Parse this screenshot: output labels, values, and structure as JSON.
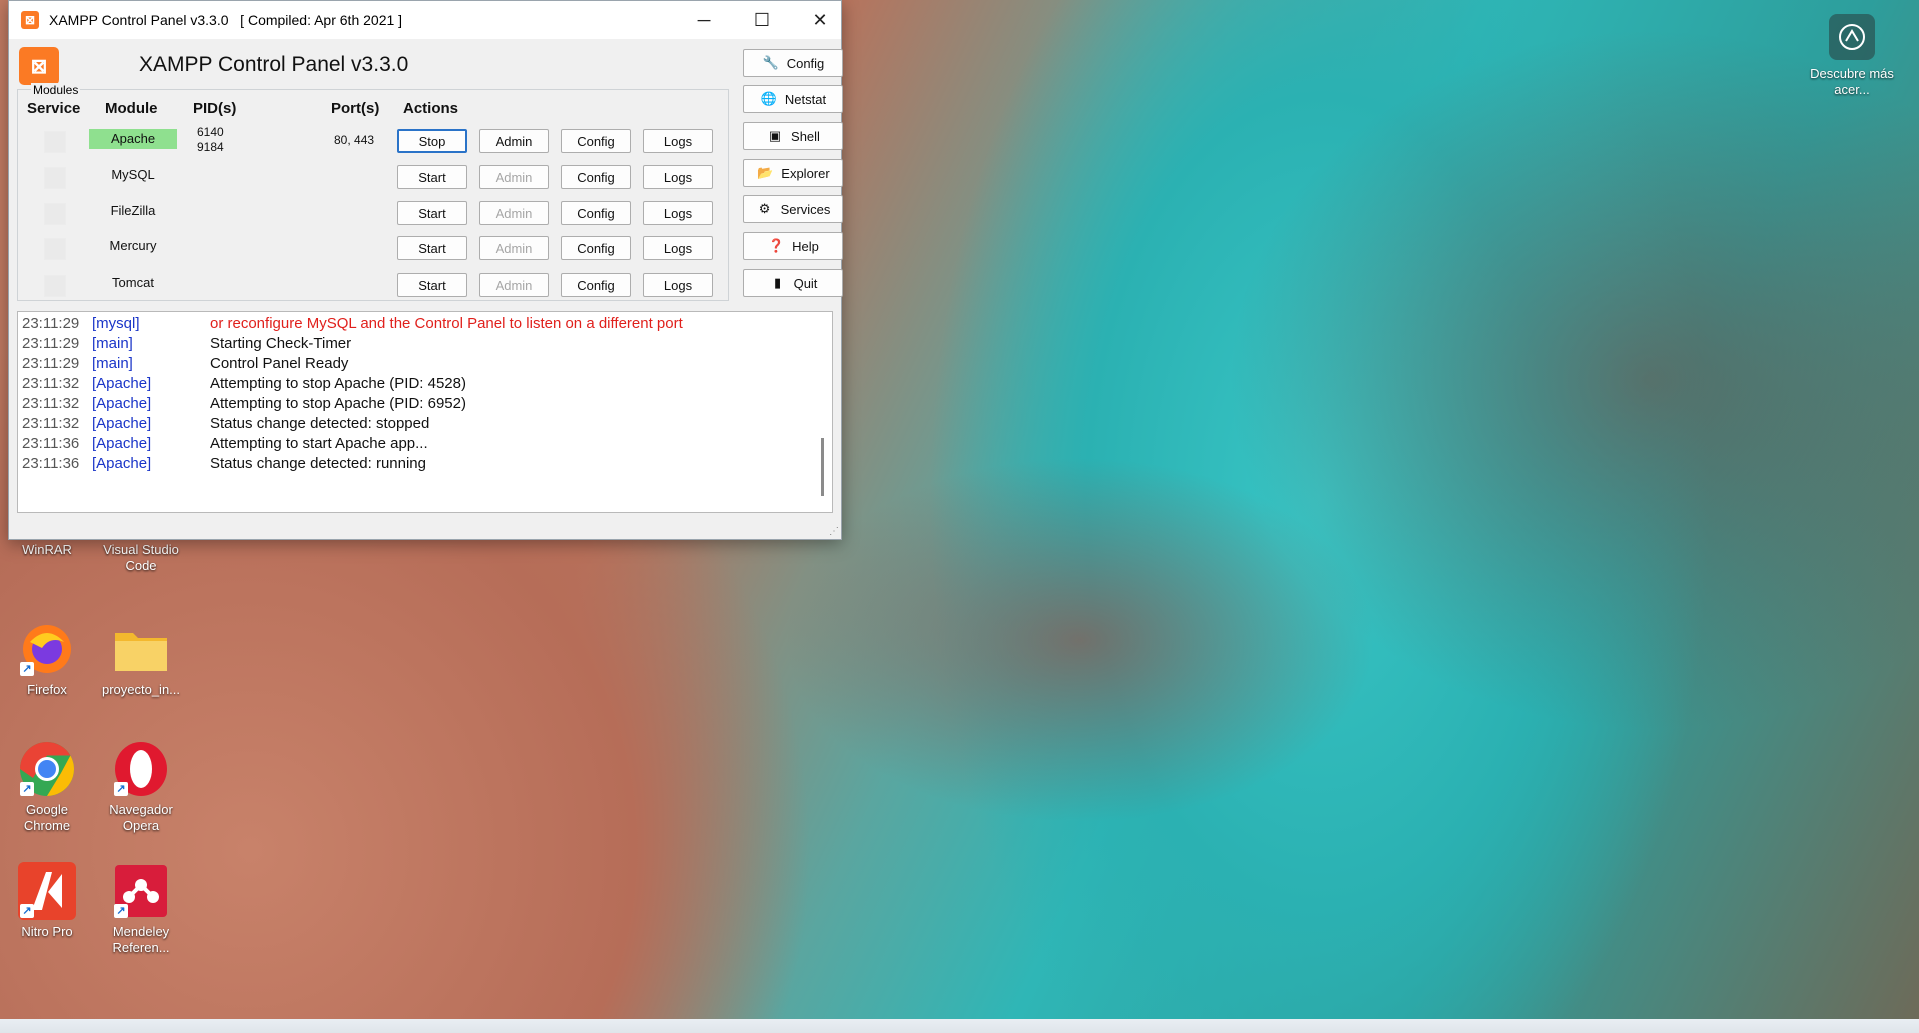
{
  "window": {
    "title": "XAMPP Control Panel v3.3.0   [ Compiled: Apr 6th 2021 ]",
    "minimize_glyph": "─",
    "maximize_glyph": "☐",
    "close_glyph": "✕",
    "header_title": "XAMPP Control Panel v3.3.0",
    "logo_glyph": "⊠"
  },
  "modules_frame_label": "Modules",
  "columns": {
    "service": "Service",
    "module": "Module",
    "pids": "PID(s)",
    "ports": "Port(s)",
    "actions": "Actions"
  },
  "modules": [
    {
      "name": "Apache",
      "status": "running",
      "pid1": "6140",
      "pid2": "9184",
      "port": "80, 443",
      "toggle": "Stop",
      "admin": "Admin",
      "admin_enabled": true,
      "config": "Config",
      "logs": "Logs"
    },
    {
      "name": "MySQL",
      "status": "stopped",
      "pid1": "",
      "pid2": "",
      "port": "",
      "toggle": "Start",
      "admin": "Admin",
      "admin_enabled": false,
      "config": "Config",
      "logs": "Logs"
    },
    {
      "name": "FileZilla",
      "status": "stopped",
      "pid1": "",
      "pid2": "",
      "port": "",
      "toggle": "Start",
      "admin": "Admin",
      "admin_enabled": false,
      "config": "Config",
      "logs": "Logs"
    },
    {
      "name": "Mercury",
      "status": "stopped",
      "pid1": "",
      "pid2": "",
      "port": "",
      "toggle": "Start",
      "admin": "Admin",
      "admin_enabled": false,
      "config": "Config",
      "logs": "Logs"
    },
    {
      "name": "Tomcat",
      "status": "stopped",
      "pid1": "",
      "pid2": "",
      "port": "",
      "toggle": "Start",
      "admin": "Admin",
      "admin_enabled": false,
      "config": "Config",
      "logs": "Logs"
    }
  ],
  "side_buttons": [
    {
      "label": "Config",
      "icon": "wrench-icon",
      "glyph": "🔧"
    },
    {
      "label": "Netstat",
      "icon": "globe-icon",
      "glyph": "🌐"
    },
    {
      "label": "Shell",
      "icon": "terminal-icon",
      "glyph": "▣"
    },
    {
      "label": "Explorer",
      "icon": "folder-icon",
      "glyph": "📂"
    },
    {
      "label": "Services",
      "icon": "services-icon",
      "glyph": "⚙"
    },
    {
      "label": "Help",
      "icon": "help-icon",
      "glyph": "❓"
    },
    {
      "label": "Quit",
      "icon": "quit-icon",
      "glyph": "▮"
    }
  ],
  "log": [
    {
      "time": "23:11:29",
      "module": "[mysql]",
      "message": "or reconfigure MySQL and the Control Panel to listen on a different port",
      "error": true
    },
    {
      "time": "23:11:29",
      "module": "[main]",
      "message": "Starting Check-Timer",
      "error": false
    },
    {
      "time": "23:11:29",
      "module": "[main]",
      "message": "Control Panel Ready",
      "error": false
    },
    {
      "time": "23:11:32",
      "module": "[Apache]",
      "message": "Attempting to stop Apache (PID: 4528)",
      "error": false
    },
    {
      "time": "23:11:32",
      "module": "[Apache]",
      "message": "Attempting to stop Apache (PID: 6952)",
      "error": false
    },
    {
      "time": "23:11:32",
      "module": "[Apache]",
      "message": "Status change detected: stopped",
      "error": false
    },
    {
      "time": "23:11:36",
      "module": "[Apache]",
      "message": "Attempting to start Apache app...",
      "error": false
    },
    {
      "time": "23:11:36",
      "module": "[Apache]",
      "message": "Status change detected: running",
      "error": false
    }
  ],
  "desktop": {
    "learn_more": "Descubre más acer...",
    "icons": [
      {
        "label": "WinRAR",
        "name": "winrar-icon",
        "color": "#7a3b8f"
      },
      {
        "label": "Visual Studio Code",
        "name": "vscode-icon",
        "color": "#1f7fd6"
      },
      {
        "label": "Firefox",
        "name": "firefox-icon",
        "color": "#ff7a1a"
      },
      {
        "label": "proyecto_in...",
        "name": "folder-icon",
        "color": "#f6c443"
      },
      {
        "label": "Google Chrome",
        "name": "chrome-icon",
        "color": "#34a853"
      },
      {
        "label": "Navegador Opera",
        "name": "opera-icon",
        "color": "#e0192f"
      },
      {
        "label": "Nitro Pro",
        "name": "nitro-pro-icon",
        "color": "#e8432b"
      },
      {
        "label": "Mendeley Referen...",
        "name": "mendeley-icon",
        "color": "#d81d3b"
      }
    ]
  }
}
